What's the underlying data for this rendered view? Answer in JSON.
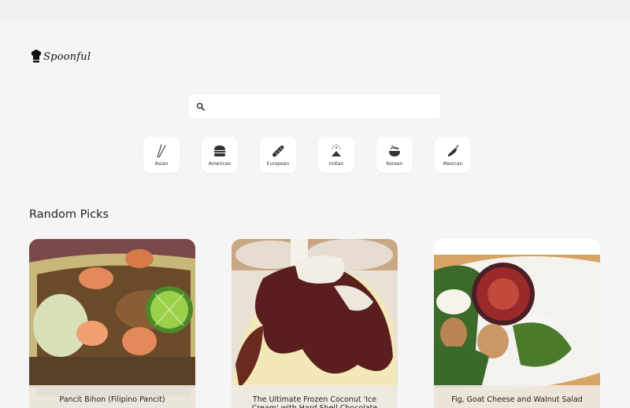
{
  "app": {
    "name": "Spoonful"
  },
  "search": {
    "placeholder": ""
  },
  "categories": [
    {
      "label": "Asian",
      "icon": "chopsticks-icon"
    },
    {
      "label": "American",
      "icon": "burger-icon"
    },
    {
      "label": "European",
      "icon": "baguette-icon"
    },
    {
      "label": "Indian",
      "icon": "spice-icon"
    },
    {
      "label": "Korean",
      "icon": "noodle-bowl-icon"
    },
    {
      "label": "Mexican",
      "icon": "chili-pepper-icon"
    }
  ],
  "section": {
    "title": "Random Picks"
  },
  "cards": [
    {
      "title": "Pancit Bihon (Filipino Pancit)"
    },
    {
      "title": "The Ultimate Frozen Coconut 'Ice Cream' with Hard Shell Chocolate Sauce"
    },
    {
      "title": "Fig, Goat Cheese and Walnut Salad"
    }
  ]
}
